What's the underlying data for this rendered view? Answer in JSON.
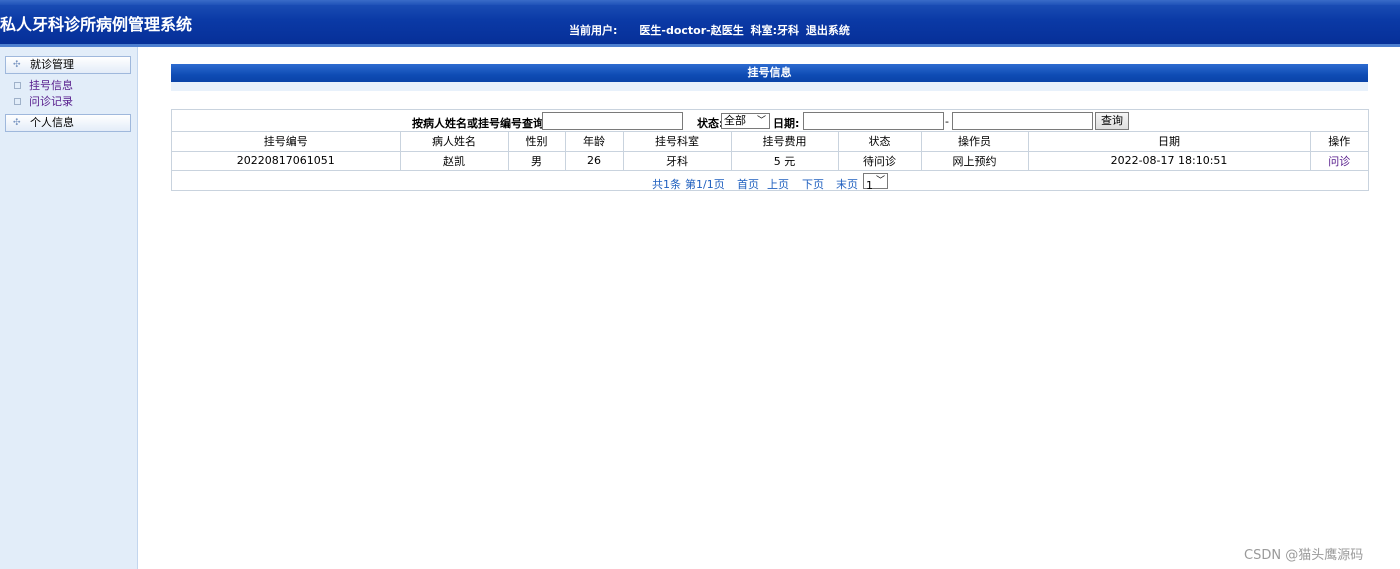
{
  "header": {
    "app_title": "私人牙科诊所病例管理系统",
    "current_user_label": "当前用户:",
    "user_info": "医生-doctor-赵医生",
    "dept_info": "科室:牙科",
    "logout_label": "退出系统"
  },
  "sidebar": {
    "group1_label": "就诊管理",
    "items": [
      {
        "label": "挂号信息"
      },
      {
        "label": "问诊记录"
      }
    ],
    "group2_label": "个人信息"
  },
  "main": {
    "title": "挂号信息",
    "search": {
      "query_label": "按病人姓名或挂号编号查询:",
      "query_value": "",
      "status_label": "状态:",
      "status_value": "全部",
      "date_label": "日期:",
      "date_from": "",
      "date_sep": "-",
      "date_to": "",
      "button_label": "查询"
    },
    "table": {
      "columns": [
        "挂号编号",
        "病人姓名",
        "性别",
        "年龄",
        "挂号科室",
        "挂号费用",
        "状态",
        "操作员",
        "日期",
        "操作"
      ],
      "rows": [
        {
          "reg_no": "20220817061051",
          "patient": "赵凯",
          "gender": "男",
          "age": "26",
          "dept": "牙科",
          "fee": "5 元",
          "status": "待问诊",
          "operator": "网上预约",
          "date": "2022-08-17 18:10:51",
          "action": "问诊"
        }
      ]
    },
    "pager": {
      "total": "共1条",
      "page_info": "第1/1页",
      "first": "首页",
      "prev": "上页",
      "next": "下页",
      "last": "末页",
      "page_select": "1"
    }
  },
  "watermark": "CSDN @猫头鹰源码",
  "colors": {
    "header_blue": "#0b3aa6",
    "sidebar_bg": "#e2edf9",
    "link_blue": "#1f5fbf",
    "visited_purple": "#551a8b"
  }
}
